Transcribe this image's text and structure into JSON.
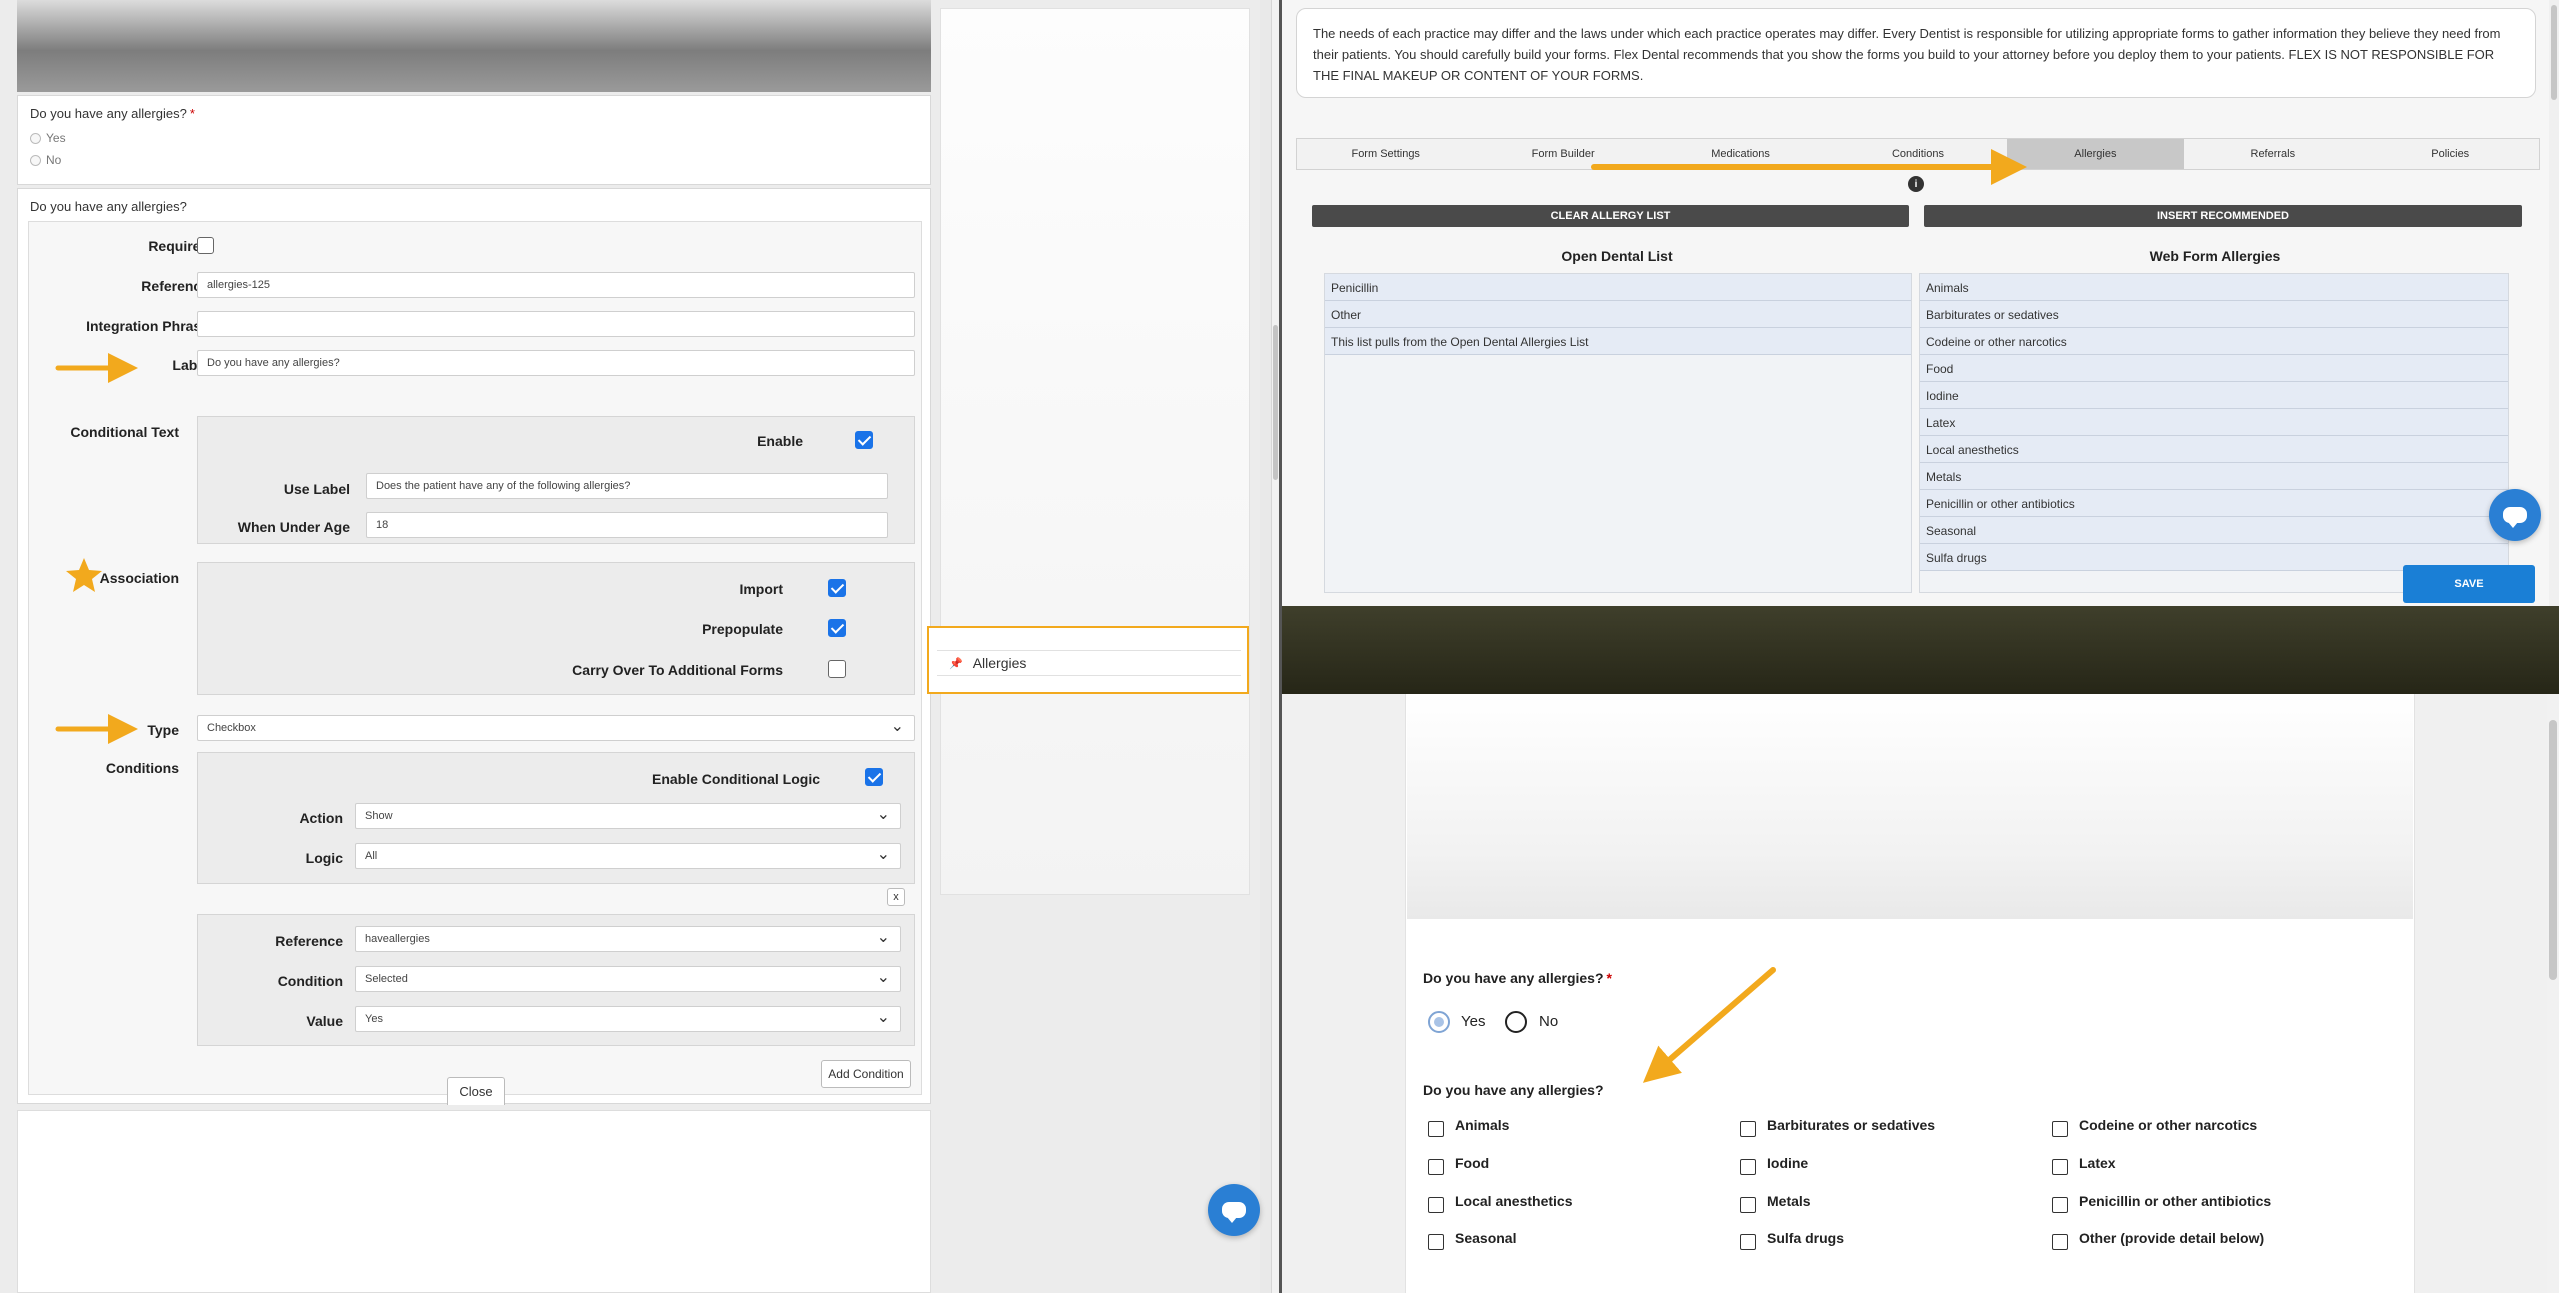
{
  "preview": {
    "question": "Do you have any allergies?",
    "required_mark": "*",
    "yes": "Yes",
    "no": "No"
  },
  "editor": {
    "title": "Do you have any allergies?",
    "required_label": "Required",
    "reference_label": "Reference",
    "reference_value": "allergies-125",
    "integration_label": "Integration Phrase",
    "integration_value": "",
    "label_label": "Label",
    "label_value": "Do you have any allergies?",
    "conditional_text_label": "Conditional Text",
    "enable_label": "Enable",
    "use_label_label": "Use Label",
    "use_label_value": "Does the patient have any of the following allergies?",
    "under_age_label": "When Under Age",
    "under_age_value": "18",
    "association_label": "Association",
    "import_label": "Import",
    "prepopulate_label": "Prepopulate",
    "carry_over_label": "Carry Over To Additional Forms",
    "type_label": "Type",
    "type_value": "Checkbox",
    "conditions_label": "Conditions",
    "enable_logic_label": "Enable Conditional Logic",
    "action_label": "Action",
    "action_value": "Show",
    "logic_label": "Logic",
    "logic_value": "All",
    "remove_label": "x",
    "cond_reference_label": "Reference",
    "cond_reference_value": "haveallergies",
    "condition_label": "Condition",
    "condition_value": "Selected",
    "value_label": "Value",
    "value_value": "Yes",
    "add_condition_label": "Add Condition",
    "close_label": "Close"
  },
  "middle": {
    "field_label": "Allergies",
    "pin_icon": "pin-icon"
  },
  "settings": {
    "disclaimer": "The needs of each practice may differ and the laws under which each practice operates may differ.   Every Dentist is responsible for utilizing appropriate forms to gather information they believe they need from their patients.   You should carefully build your forms.   Flex Dental recommends that you show the forms you build to your attorney before you deploy them to your patients.   FLEX IS NOT RESPONSIBLE FOR THE FINAL MAKEUP OR CONTENT OF YOUR FORMS.",
    "tabs": [
      "Form Settings",
      "Form Builder",
      "Medications",
      "Conditions",
      "Allergies",
      "Referrals",
      "Policies"
    ],
    "active_tab": "Allergies",
    "info_glyph": "i",
    "clear_btn": "CLEAR ALLERGY LIST",
    "insert_btn": "INSERT RECOMMENDED",
    "open_dental_title": "Open Dental List",
    "web_form_title": "Web Form Allergies",
    "open_dental_items": [
      "Penicillin",
      "Other",
      "This list pulls from the Open Dental Allergies List"
    ],
    "web_form_items": [
      "Animals",
      "Barbiturates or sedatives",
      "Codeine or other narcotics",
      "Food",
      "Iodine",
      "Latex",
      "Local anesthetics",
      "Metals",
      "Penicillin or other antibiotics",
      "Seasonal",
      "Sulfa drugs"
    ],
    "save_btn": "SAVE"
  },
  "patient_form": {
    "q1": "Do you have any allergies?",
    "required_mark": "*",
    "yes": "Yes",
    "no": "No",
    "q2": "Do you have any allergies?",
    "options": [
      "Animals",
      "Barbiturates or sedatives",
      "Codeine or other narcotics",
      "Food",
      "Iodine",
      "Latex",
      "Local anesthetics",
      "Metals",
      "Penicillin or other antibiotics",
      "Seasonal",
      "Sulfa drugs",
      "Other (provide detail below)"
    ]
  },
  "colors": {
    "accent_orange": "#f2a91d",
    "brand_blue": "#1a7fd6",
    "checkbox_blue": "#1a73e8"
  }
}
